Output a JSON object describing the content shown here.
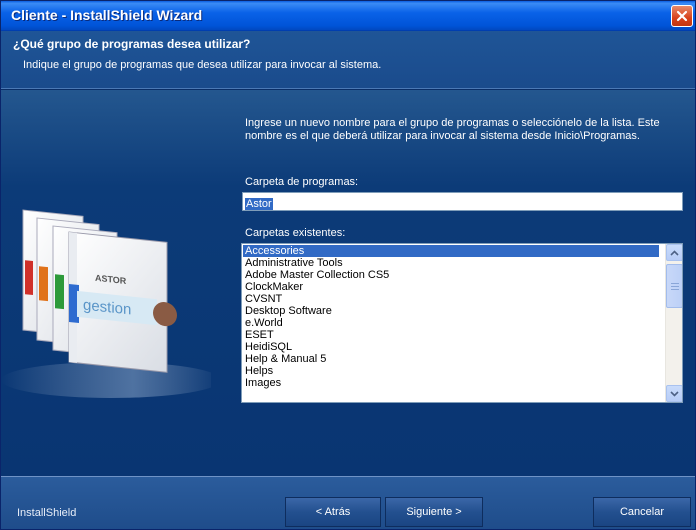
{
  "window": {
    "title": "Cliente - InstallShield Wizard"
  },
  "header": {
    "title": "¿Qué grupo de programas desea utilizar?",
    "description": "Indique el grupo de programas que desea utilizar para invocar al sistema."
  },
  "main": {
    "intro": "Ingrese un nuevo nombre para el grupo de programas o selecciónelo de la lista. Este nombre es el que deberá utilizar para invocar al sistema desde Inicio\\Programas.",
    "folder_label": "Carpeta de programas:",
    "folder_value": "Astor",
    "existing_label": "Carpetas existentes:",
    "existing_folders": [
      "Accessories",
      "Administrative Tools",
      "Adobe Master Collection CS5",
      "ClockMaker",
      "CVSNT",
      "Desktop Software",
      "e.World",
      "ESET",
      "HeidiSQL",
      "Help & Manual 5",
      "Helps",
      "Images"
    ],
    "selected_index": 0,
    "product_box_brand": "ASTOR",
    "product_box_name": "gestion"
  },
  "footer": {
    "brand": "InstallShield",
    "back_label": "< Atrás",
    "next_label": "Siguiente >",
    "cancel_label": "Cancelar"
  },
  "colors": {
    "titlebar": "#0a5ee0",
    "background": "#0b3a78",
    "selection": "#316ac5",
    "close_button": "#d8421c"
  }
}
